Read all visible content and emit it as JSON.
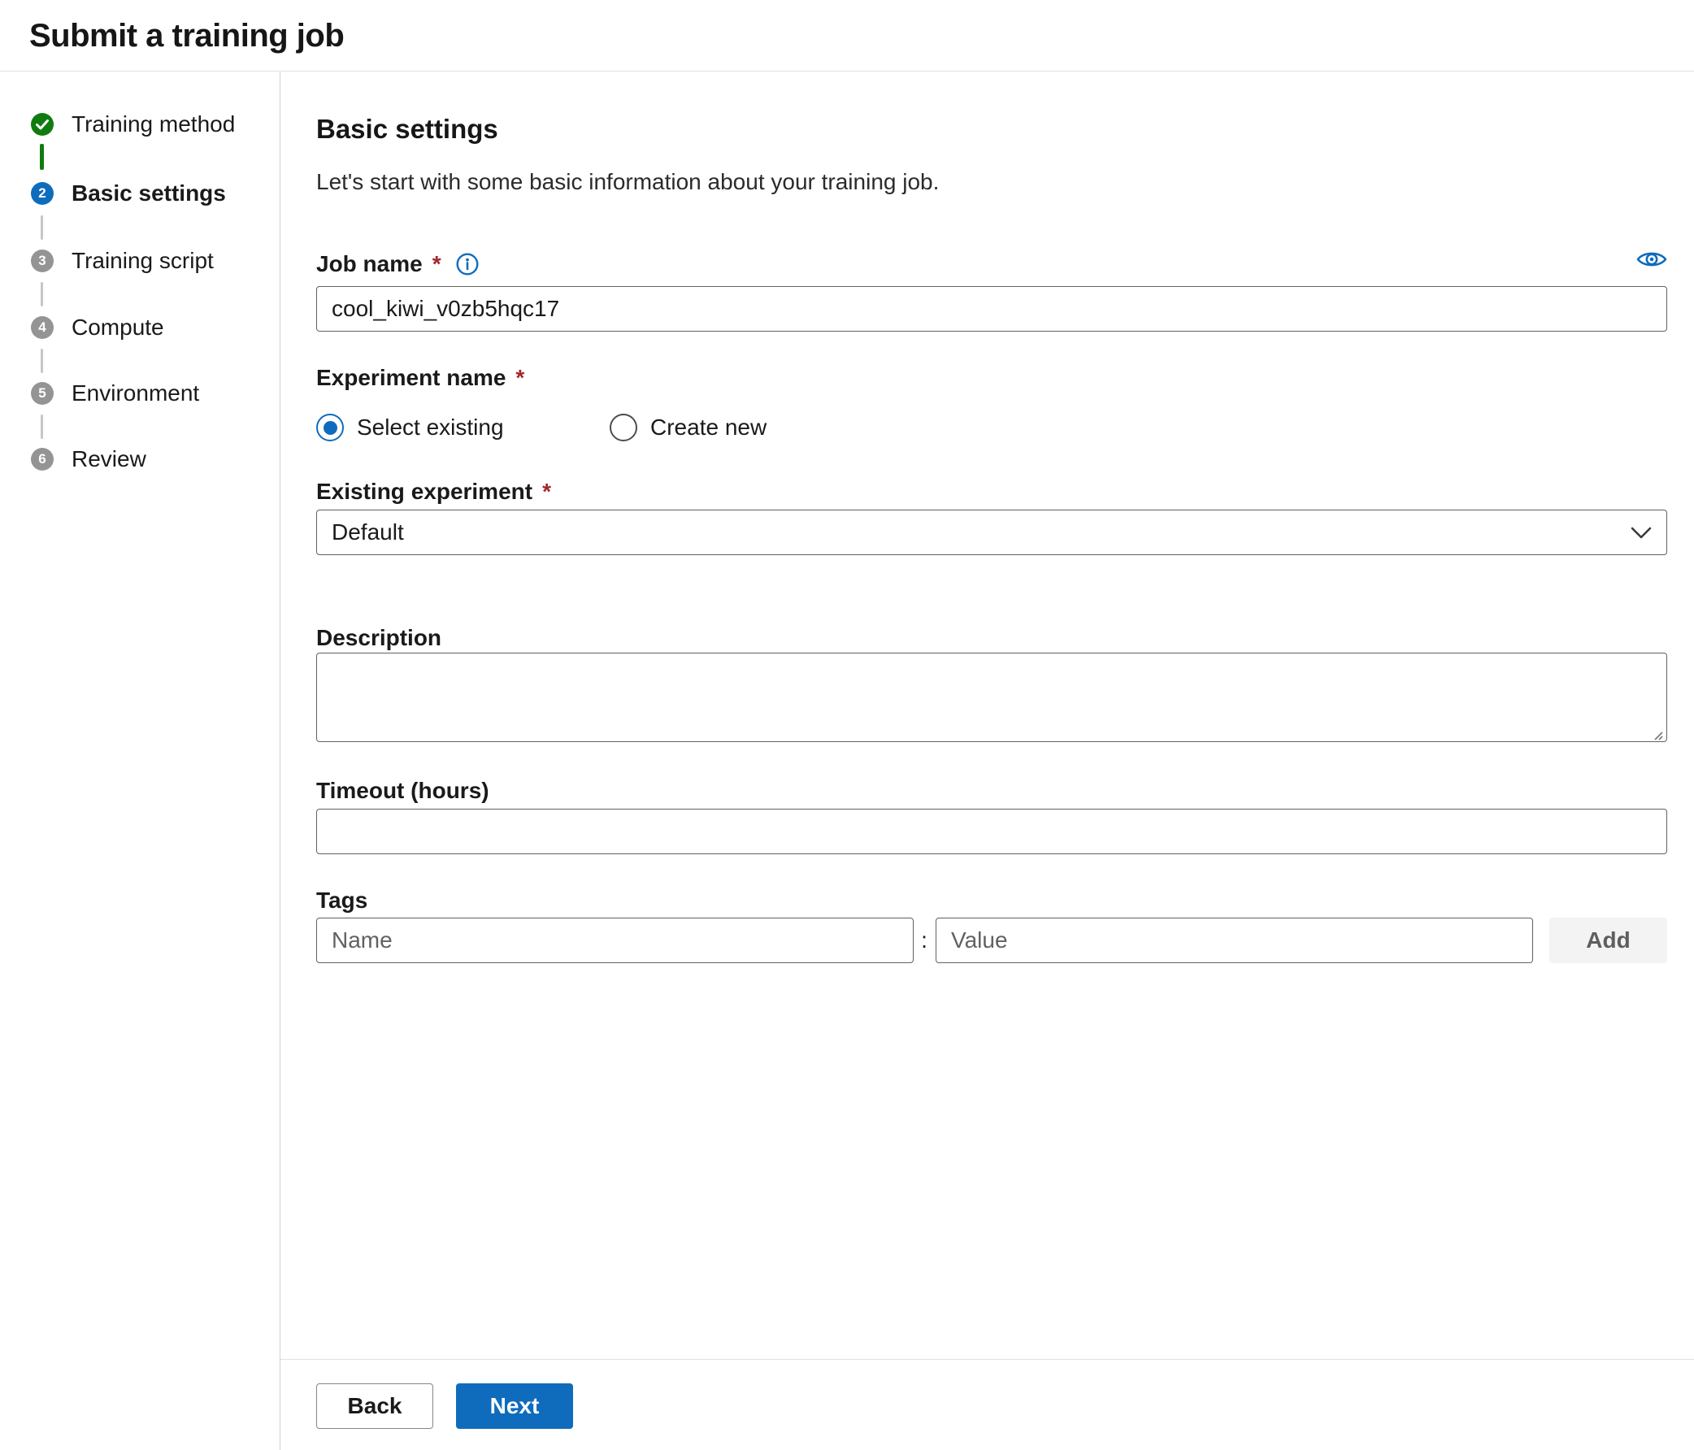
{
  "window": {
    "title": "Submit a training job"
  },
  "stepper": {
    "steps": [
      {
        "label": "Training method",
        "state": "completed",
        "icon": "checkmark-icon"
      },
      {
        "label": "Basic settings",
        "state": "current",
        "number": "2"
      },
      {
        "label": "Training script",
        "state": "upcoming",
        "number": "3"
      },
      {
        "label": "Compute",
        "state": "upcoming",
        "number": "4"
      },
      {
        "label": "Environment",
        "state": "upcoming",
        "number": "5"
      },
      {
        "label": "Review",
        "state": "upcoming",
        "number": "6"
      }
    ]
  },
  "main": {
    "heading": "Basic settings",
    "intro": "Let's start with some basic information about your training job.",
    "job_name": {
      "label": "Job name",
      "required": "*",
      "value": "cool_kiwi_v0zb5hqc17"
    },
    "experiment": {
      "label": "Experiment name",
      "required": "*",
      "options": [
        {
          "label": "Select existing",
          "selected": true
        },
        {
          "label": "Create new",
          "selected": false
        }
      ]
    },
    "existing_experiment": {
      "label": "Existing experiment",
      "required": "*",
      "value": "Default"
    },
    "description": {
      "label": "Description",
      "value": ""
    },
    "timeout": {
      "label": "Timeout (hours)",
      "value": ""
    },
    "tags": {
      "label": "Tags",
      "name_placeholder": "Name",
      "separator": ":",
      "value_placeholder": "Value",
      "add_label": "Add"
    }
  },
  "footer": {
    "back_label": "Back",
    "next_label": "Next"
  },
  "colors": {
    "accent": "#0f6cbd",
    "success": "#107c10",
    "step_gray": "#949494",
    "required_red": "#a4262c"
  }
}
